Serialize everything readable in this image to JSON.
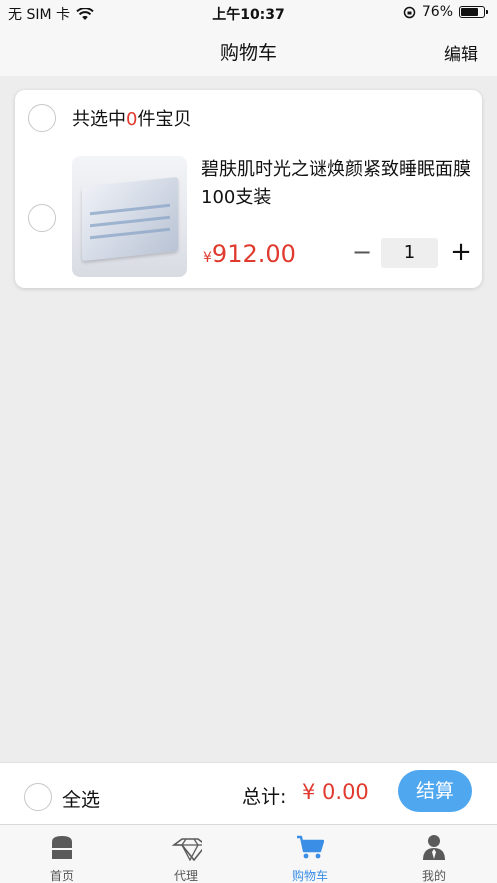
{
  "status_bar": {
    "carrier": "无 SIM 卡",
    "time": "上午10:37",
    "battery": "76%",
    "battery_level": 0.76
  },
  "nav": {
    "title": "购物车",
    "edit_label": "编辑"
  },
  "cart": {
    "header": {
      "prefix": "共选中",
      "count": "0",
      "suffix": "件宝贝"
    },
    "item": {
      "title": "碧肤肌时光之谜焕颜紧致睡眠面膜100支装",
      "currency": "¥",
      "price": "912.00",
      "quantity": "1",
      "minus": "−",
      "plus": "+"
    }
  },
  "checkout": {
    "select_all": "全选",
    "total_label": "总计:",
    "total_value": "¥ 0.00",
    "pay_label": "结算"
  },
  "tabs": [
    {
      "label": "首页",
      "icon": "home-icon"
    },
    {
      "label": "代理",
      "icon": "diamond-icon"
    },
    {
      "label": "购物车",
      "icon": "cart-icon",
      "active": true
    },
    {
      "label": "我的",
      "icon": "user-icon"
    }
  ],
  "colors": {
    "accent": "#e03a2f",
    "primary": "#4fa7f0",
    "tab_active": "#3a8ee6"
  }
}
